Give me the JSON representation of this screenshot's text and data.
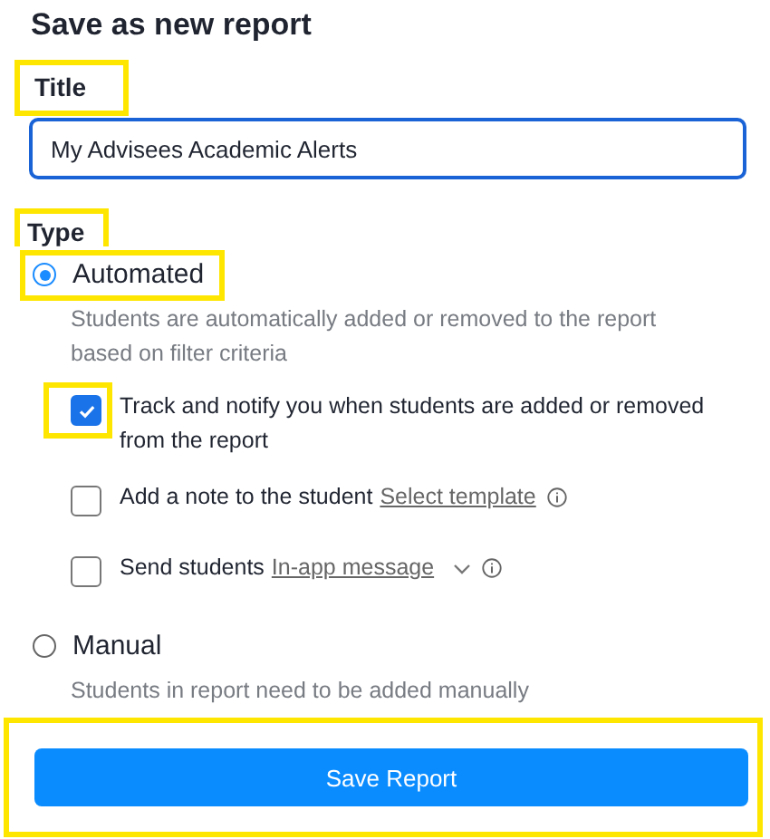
{
  "heading": "Save as new report",
  "title_field": {
    "label": "Title",
    "label_highlighted": true,
    "value": "My Advisees Academic Alerts",
    "focused": true
  },
  "type_section": {
    "label": "Type",
    "label_highlighted": true,
    "options": [
      {
        "label": "Automated",
        "selected": true,
        "highlighted": true,
        "description": "Students are automatically added or removed to the report based on filter criteria",
        "checkboxes": [
          {
            "label": "Track and notify you when students are added or removed from the report",
            "dropdown": false,
            "info": false,
            "checked": true,
            "highlighted": true
          },
          {
            "label": "Add a note to the student",
            "link": "Select template",
            "dropdown": false,
            "info": true,
            "checked": false,
            "highlighted": false
          },
          {
            "label": "Send students",
            "link": "In-app message",
            "dropdown": true,
            "info": true,
            "checked": false,
            "highlighted": false
          }
        ]
      },
      {
        "label": "Manual",
        "selected": false,
        "highlighted": false,
        "description": "Students in report need to be added manually"
      }
    ]
  },
  "save_button": {
    "label": "Save Report",
    "highlighted": true
  }
}
